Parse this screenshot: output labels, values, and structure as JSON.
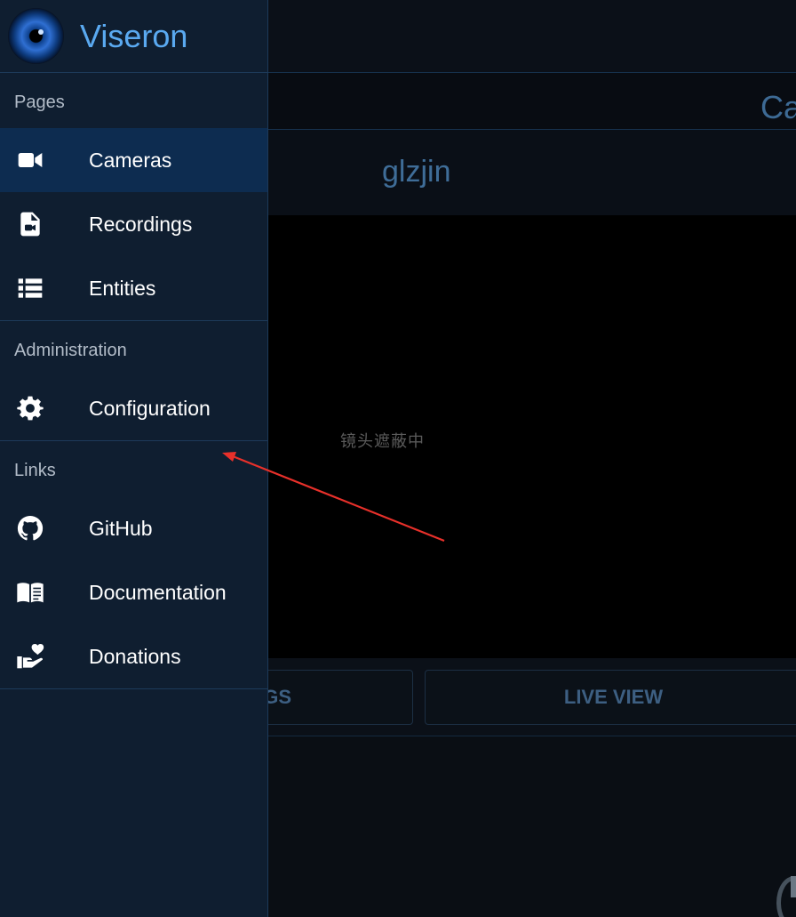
{
  "app": {
    "name": "Viseron"
  },
  "background": {
    "page_title": "Ca",
    "camera_name": "glzjin",
    "video_overlay_text": "镜头遮蔽中",
    "buttons": {
      "recordings_label": "GS",
      "live_view_label": "LIVE VIEW"
    }
  },
  "drawer": {
    "sections": [
      {
        "title": "Pages",
        "items": [
          {
            "label": "Cameras",
            "icon": "videocam-icon",
            "active": true
          },
          {
            "label": "Recordings",
            "icon": "video-file-icon",
            "active": false
          },
          {
            "label": "Entities",
            "icon": "list-icon",
            "active": false
          }
        ]
      },
      {
        "title": "Administration",
        "items": [
          {
            "label": "Configuration",
            "icon": "gear-icon",
            "active": false
          }
        ]
      },
      {
        "title": "Links",
        "items": [
          {
            "label": "GitHub",
            "icon": "github-icon",
            "active": false
          },
          {
            "label": "Documentation",
            "icon": "book-icon",
            "active": false
          },
          {
            "label": "Donations",
            "icon": "hand-heart-icon",
            "active": false
          }
        ]
      }
    ]
  },
  "colors": {
    "accent": "#5aa9f0",
    "drawer_bg": "#0f1e30",
    "active_bg": "#0d2c50",
    "annotation_arrow": "#e8302a"
  }
}
